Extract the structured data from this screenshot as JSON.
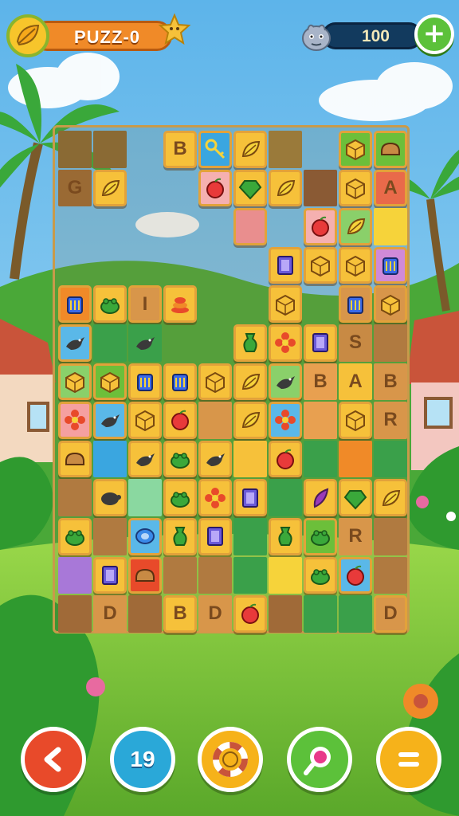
{
  "header": {
    "level_label": "PUZZ-0",
    "score_value": "100",
    "add_symbol": "+"
  },
  "board": {
    "columns": 10,
    "rows": 13,
    "tiles": [
      {
        "c": 0,
        "r": 0,
        "bg": "#8a6a34",
        "style": "flat",
        "icon": ""
      },
      {
        "c": 1,
        "r": 0,
        "bg": "#8a6a34",
        "style": "flat",
        "icon": ""
      },
      {
        "c": 3,
        "r": 0,
        "bg": "#f6c13a",
        "style": "raised",
        "icon": "",
        "letter": "B"
      },
      {
        "c": 4,
        "r": 0,
        "bg": "#3aa6e0",
        "style": "raised",
        "icon": "key-icon"
      },
      {
        "c": 5,
        "r": 0,
        "bg": "#f6c13a",
        "style": "raised",
        "icon": "leaf-icon"
      },
      {
        "c": 6,
        "r": 0,
        "bg": "#9a7a3a",
        "style": "flat",
        "icon": ""
      },
      {
        "c": 8,
        "r": 0,
        "bg": "#6cbf3a",
        "style": "raised",
        "icon": "cube-icon"
      },
      {
        "c": 9,
        "r": 0,
        "bg": "#6cbf3a",
        "style": "raised",
        "icon": "bread-icon"
      },
      {
        "c": 0,
        "r": 1,
        "bg": "#9a6a34",
        "style": "flat",
        "icon": "",
        "letter": "G"
      },
      {
        "c": 1,
        "r": 1,
        "bg": "#f6c13a",
        "style": "raised",
        "icon": "leaf-icon"
      },
      {
        "c": 4,
        "r": 1,
        "bg": "#f5b0b0",
        "style": "raised",
        "icon": "apple-icon"
      },
      {
        "c": 5,
        "r": 1,
        "bg": "#f6c13a",
        "style": "raised",
        "icon": "gem-icon"
      },
      {
        "c": 6,
        "r": 1,
        "bg": "#f6c13a",
        "style": "raised",
        "icon": "leaf-icon"
      },
      {
        "c": 7,
        "r": 1,
        "bg": "#8a5a34",
        "style": "flat",
        "icon": ""
      },
      {
        "c": 8,
        "r": 1,
        "bg": "#f6c13a",
        "style": "raised",
        "icon": "cube-icon"
      },
      {
        "c": 9,
        "r": 1,
        "bg": "#e96a4a",
        "style": "raised",
        "icon": "",
        "letter": "A"
      },
      {
        "c": 5,
        "r": 2,
        "bg": "#e98e8e",
        "style": "raised",
        "icon": ""
      },
      {
        "c": 7,
        "r": 2,
        "bg": "#f5b0b0",
        "style": "raised",
        "icon": "apple-icon"
      },
      {
        "c": 8,
        "r": 2,
        "bg": "#8ad06a",
        "style": "raised",
        "icon": "leaf-icon"
      },
      {
        "c": 9,
        "r": 2,
        "bg": "#f6d33a",
        "style": "flat",
        "icon": ""
      },
      {
        "c": 6,
        "r": 3,
        "bg": "#f6c13a",
        "style": "raised",
        "icon": "card-icon"
      },
      {
        "c": 7,
        "r": 3,
        "bg": "#f6c13a",
        "style": "raised",
        "icon": "cube-icon"
      },
      {
        "c": 8,
        "r": 3,
        "bg": "#f6c13a",
        "style": "raised",
        "icon": "cube-icon"
      },
      {
        "c": 9,
        "r": 3,
        "bg": "#d08ad8",
        "style": "raised",
        "icon": "lantern-icon"
      },
      {
        "c": 0,
        "r": 4,
        "bg": "#f08a28",
        "style": "raised",
        "icon": "lantern-icon"
      },
      {
        "c": 1,
        "r": 4,
        "bg": "#f6c13a",
        "style": "raised",
        "icon": "frog-icon"
      },
      {
        "c": 2,
        "r": 4,
        "bg": "#d8964a",
        "style": "raised",
        "icon": "",
        "letter": "I"
      },
      {
        "c": 3,
        "r": 4,
        "bg": "#f6c13a",
        "style": "raised",
        "icon": "stack-icon"
      },
      {
        "c": 6,
        "r": 4,
        "bg": "#f6c13a",
        "style": "raised",
        "icon": "cube-icon"
      },
      {
        "c": 8,
        "r": 4,
        "bg": "#d8964a",
        "style": "raised",
        "icon": "lantern-icon"
      },
      {
        "c": 9,
        "r": 4,
        "bg": "#d8964a",
        "style": "raised",
        "icon": "cube-icon"
      },
      {
        "c": 0,
        "r": 5,
        "bg": "#5ab8e8",
        "style": "raised",
        "icon": "crow-icon"
      },
      {
        "c": 1,
        "r": 5,
        "bg": "#3aa04a",
        "style": "flat",
        "icon": ""
      },
      {
        "c": 2,
        "r": 5,
        "bg": "#3aa04a",
        "style": "flat",
        "icon": "crow-icon"
      },
      {
        "c": 5,
        "r": 5,
        "bg": "#f6c13a",
        "style": "raised",
        "icon": "vase-icon"
      },
      {
        "c": 6,
        "r": 5,
        "bg": "#f6c13a",
        "style": "raised",
        "icon": "flower-icon"
      },
      {
        "c": 7,
        "r": 5,
        "bg": "#f6c13a",
        "style": "raised",
        "icon": "card-icon"
      },
      {
        "c": 8,
        "r": 5,
        "bg": "#c88a44",
        "style": "flat",
        "icon": "",
        "letter": "S"
      },
      {
        "c": 9,
        "r": 5,
        "bg": "#b07a40",
        "style": "flat",
        "icon": ""
      },
      {
        "c": 0,
        "r": 6,
        "bg": "#8ad06a",
        "style": "raised",
        "icon": "cube-icon"
      },
      {
        "c": 1,
        "r": 6,
        "bg": "#6cbf3a",
        "style": "raised",
        "icon": "cube-icon"
      },
      {
        "c": 2,
        "r": 6,
        "bg": "#f6c13a",
        "style": "raised",
        "icon": "lantern-icon"
      },
      {
        "c": 3,
        "r": 6,
        "bg": "#f6c13a",
        "style": "raised",
        "icon": "lantern-icon"
      },
      {
        "c": 4,
        "r": 6,
        "bg": "#f6c13a",
        "style": "raised",
        "icon": "cube-icon"
      },
      {
        "c": 5,
        "r": 6,
        "bg": "#f6c13a",
        "style": "raised",
        "icon": "leaf-icon"
      },
      {
        "c": 6,
        "r": 6,
        "bg": "#8ad06a",
        "style": "raised",
        "icon": "crow-icon"
      },
      {
        "c": 7,
        "r": 6,
        "bg": "#e8a050",
        "style": "flat",
        "icon": "",
        "letter": "B"
      },
      {
        "c": 8,
        "r": 6,
        "bg": "#f6c13a",
        "style": "flat",
        "icon": "",
        "letter": "A"
      },
      {
        "c": 9,
        "r": 6,
        "bg": "#d8964a",
        "style": "flat",
        "icon": "",
        "letter": "B"
      },
      {
        "c": 0,
        "r": 7,
        "bg": "#f5a0a0",
        "style": "raised",
        "icon": "flower-icon"
      },
      {
        "c": 1,
        "r": 7,
        "bg": "#5ab8e8",
        "style": "raised",
        "icon": "crow-icon"
      },
      {
        "c": 2,
        "r": 7,
        "bg": "#f6c13a",
        "style": "raised",
        "icon": "cube-icon"
      },
      {
        "c": 3,
        "r": 7,
        "bg": "#f6c13a",
        "style": "raised",
        "icon": "apple-icon"
      },
      {
        "c": 4,
        "r": 7,
        "bg": "#d8964a",
        "style": "flat",
        "icon": ""
      },
      {
        "c": 5,
        "r": 7,
        "bg": "#f6c13a",
        "style": "raised",
        "icon": "leaf-icon"
      },
      {
        "c": 6,
        "r": 7,
        "bg": "#5ab8e8",
        "style": "raised",
        "icon": "flower-icon"
      },
      {
        "c": 7,
        "r": 7,
        "bg": "#e8a050",
        "style": "flat",
        "icon": ""
      },
      {
        "c": 8,
        "r": 7,
        "bg": "#f6c13a",
        "style": "raised",
        "icon": "cube-icon"
      },
      {
        "c": 9,
        "r": 7,
        "bg": "#d8964a",
        "style": "flat",
        "icon": "",
        "letter": "R"
      },
      {
        "c": 0,
        "r": 8,
        "bg": "#f6c13a",
        "style": "raised",
        "icon": "bread-icon"
      },
      {
        "c": 1,
        "r": 8,
        "bg": "#3aa6e0",
        "style": "flat",
        "icon": ""
      },
      {
        "c": 2,
        "r": 8,
        "bg": "#f6c13a",
        "style": "raised",
        "icon": "crow-icon"
      },
      {
        "c": 3,
        "r": 8,
        "bg": "#f6c13a",
        "style": "raised",
        "icon": "frog-icon"
      },
      {
        "c": 4,
        "r": 8,
        "bg": "#f6c13a",
        "style": "raised",
        "icon": "crow-icon"
      },
      {
        "c": 5,
        "r": 8,
        "bg": "#f6c13a",
        "style": "flat",
        "icon": ""
      },
      {
        "c": 6,
        "r": 8,
        "bg": "#f6c13a",
        "style": "raised",
        "icon": "apple-icon"
      },
      {
        "c": 7,
        "r": 8,
        "bg": "#3aa04a",
        "style": "flat",
        "icon": ""
      },
      {
        "c": 8,
        "r": 8,
        "bg": "#f08a28",
        "style": "flat",
        "icon": ""
      },
      {
        "c": 9,
        "r": 8,
        "bg": "#3aa04a",
        "style": "flat",
        "icon": ""
      },
      {
        "c": 0,
        "r": 9,
        "bg": "#b07a40",
        "style": "flat",
        "icon": ""
      },
      {
        "c": 1,
        "r": 9,
        "bg": "#f6c13a",
        "style": "raised",
        "icon": "turtle-icon"
      },
      {
        "c": 2,
        "r": 9,
        "bg": "#8ad8a0",
        "style": "flat",
        "icon": ""
      },
      {
        "c": 3,
        "r": 9,
        "bg": "#f6c13a",
        "style": "raised",
        "icon": "frog-icon"
      },
      {
        "c": 4,
        "r": 9,
        "bg": "#f6c13a",
        "style": "raised",
        "icon": "flower-icon"
      },
      {
        "c": 5,
        "r": 9,
        "bg": "#f6c13a",
        "style": "raised",
        "icon": "card-icon"
      },
      {
        "c": 6,
        "r": 9,
        "bg": "#3aa04a",
        "style": "flat",
        "icon": ""
      },
      {
        "c": 7,
        "r": 9,
        "bg": "#f6c13a",
        "style": "raised",
        "icon": "feather-icon"
      },
      {
        "c": 8,
        "r": 9,
        "bg": "#f6c13a",
        "style": "raised",
        "icon": "gem-icon"
      },
      {
        "c": 9,
        "r": 9,
        "bg": "#f6c13a",
        "style": "raised",
        "icon": "leaf-icon"
      },
      {
        "c": 0,
        "r": 10,
        "bg": "#f6c13a",
        "style": "raised",
        "icon": "frog-icon"
      },
      {
        "c": 1,
        "r": 10,
        "bg": "#b07a40",
        "style": "flat",
        "icon": ""
      },
      {
        "c": 2,
        "r": 10,
        "bg": "#5ab8e8",
        "style": "raised",
        "icon": "coin-icon"
      },
      {
        "c": 3,
        "r": 10,
        "bg": "#f6c13a",
        "style": "raised",
        "icon": "vase-icon"
      },
      {
        "c": 4,
        "r": 10,
        "bg": "#f6c13a",
        "style": "raised",
        "icon": "card-icon"
      },
      {
        "c": 5,
        "r": 10,
        "bg": "#3aa04a",
        "style": "flat",
        "icon": ""
      },
      {
        "c": 6,
        "r": 10,
        "bg": "#f6c13a",
        "style": "raised",
        "icon": "vase-icon"
      },
      {
        "c": 7,
        "r": 10,
        "bg": "#6cbf3a",
        "style": "raised",
        "icon": "frog-icon"
      },
      {
        "c": 8,
        "r": 10,
        "bg": "#d8964a",
        "style": "flat",
        "icon": "",
        "letter": "R"
      },
      {
        "c": 9,
        "r": 10,
        "bg": "#b07a40",
        "style": "flat",
        "icon": ""
      },
      {
        "c": 0,
        "r": 11,
        "bg": "#a878d8",
        "style": "flat",
        "icon": ""
      },
      {
        "c": 1,
        "r": 11,
        "bg": "#f6c13a",
        "style": "raised",
        "icon": "card-icon"
      },
      {
        "c": 2,
        "r": 11,
        "bg": "#e84a2a",
        "style": "raised",
        "icon": "bread-icon"
      },
      {
        "c": 3,
        "r": 11,
        "bg": "#b07a40",
        "style": "flat",
        "icon": ""
      },
      {
        "c": 4,
        "r": 11,
        "bg": "#b07a40",
        "style": "flat",
        "icon": ""
      },
      {
        "c": 5,
        "r": 11,
        "bg": "#3aa04a",
        "style": "flat",
        "icon": ""
      },
      {
        "c": 6,
        "r": 11,
        "bg": "#f6d33a",
        "style": "flat",
        "icon": ""
      },
      {
        "c": 7,
        "r": 11,
        "bg": "#f6c13a",
        "style": "raised",
        "icon": "frog-icon"
      },
      {
        "c": 8,
        "r": 11,
        "bg": "#5ab8e8",
        "style": "raised",
        "icon": "apple-icon"
      },
      {
        "c": 9,
        "r": 11,
        "bg": "#b07a40",
        "style": "flat",
        "icon": ""
      },
      {
        "c": 0,
        "r": 12,
        "bg": "#a06a38",
        "style": "flat",
        "icon": ""
      },
      {
        "c": 1,
        "r": 12,
        "bg": "#d8964a",
        "style": "flat",
        "icon": "",
        "letter": "D"
      },
      {
        "c": 2,
        "r": 12,
        "bg": "#a06a38",
        "style": "flat",
        "icon": ""
      },
      {
        "c": 3,
        "r": 12,
        "bg": "#f6c13a",
        "style": "raised",
        "icon": "",
        "letter": "B"
      },
      {
        "c": 4,
        "r": 12,
        "bg": "#d8964a",
        "style": "flat",
        "icon": "",
        "letter": "D"
      },
      {
        "c": 5,
        "r": 12,
        "bg": "#f6c13a",
        "style": "raised",
        "icon": "apple-icon"
      },
      {
        "c": 6,
        "r": 12,
        "bg": "#a06a38",
        "style": "flat",
        "icon": ""
      },
      {
        "c": 7,
        "r": 12,
        "bg": "#3aa04a",
        "style": "flat",
        "icon": ""
      },
      {
        "c": 8,
        "r": 12,
        "bg": "#3aa04a",
        "style": "flat",
        "icon": ""
      },
      {
        "c": 9,
        "r": 12,
        "bg": "#d8964a",
        "style": "raised",
        "icon": "",
        "letter": "D"
      }
    ]
  },
  "bottom_bar": {
    "moves_value": "19",
    "buttons": [
      {
        "name": "back-button",
        "icon": "chevron-left-icon",
        "color": "#e84a2a"
      },
      {
        "name": "moves-button",
        "icon": "",
        "color": "#2aa8d8"
      },
      {
        "name": "lifebuoy-button",
        "icon": "lifebuoy-icon",
        "color": "#f6b21a"
      },
      {
        "name": "hint-button",
        "icon": "magnifier-icon",
        "color": "#5cc13a"
      },
      {
        "name": "menu-button",
        "icon": "menu-icon",
        "color": "#f6b21a"
      }
    ]
  },
  "colors": {
    "sky": "#7ec8f0",
    "grass": "#7cc83a",
    "board_border": "#c89a4a",
    "accent": "#f08a28"
  }
}
